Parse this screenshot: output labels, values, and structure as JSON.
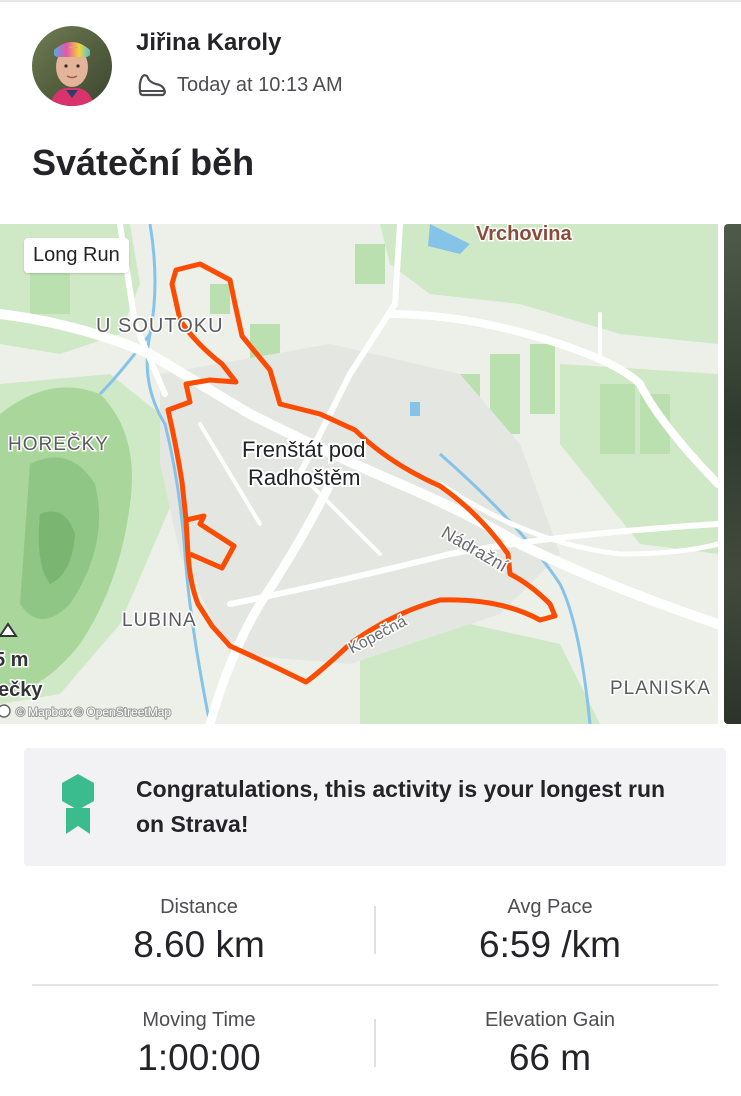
{
  "athlete": {
    "name": "Jiřina Karoly",
    "activity_icon": "shoe-icon",
    "timestamp": "Today at 10:13 AM"
  },
  "activity": {
    "title": "Sváteční běh"
  },
  "map": {
    "badge": "Long Run",
    "route_color": "#fc4c02",
    "attribution": "© Mapbox © OpenStreetMap",
    "labels": {
      "town_line1": "Frenštát pod",
      "town_line2": "Radhoštěm",
      "vrchovina": "Vrchovina",
      "u_soutoku": "U SOUTOKU",
      "horecky": "HOREČKY",
      "lubina": "LUBINA",
      "planiska": "PLANISKA",
      "nadrazni": "Nádražní",
      "kopecna": "Kopečná",
      "peak_elev": "5 m",
      "peak_name": "ečky"
    }
  },
  "achievement": {
    "icon": "medal-icon",
    "color": "#3bbc8f",
    "text": "Congratulations, this activity is your longest run on Strava!"
  },
  "stats": [
    {
      "label": "Distance",
      "value": "8.60 km"
    },
    {
      "label": "Avg Pace",
      "value": "6:59 /km"
    },
    {
      "label": "Moving Time",
      "value": "1:00:00"
    },
    {
      "label": "Elevation Gain",
      "value": "66 m"
    }
  ]
}
